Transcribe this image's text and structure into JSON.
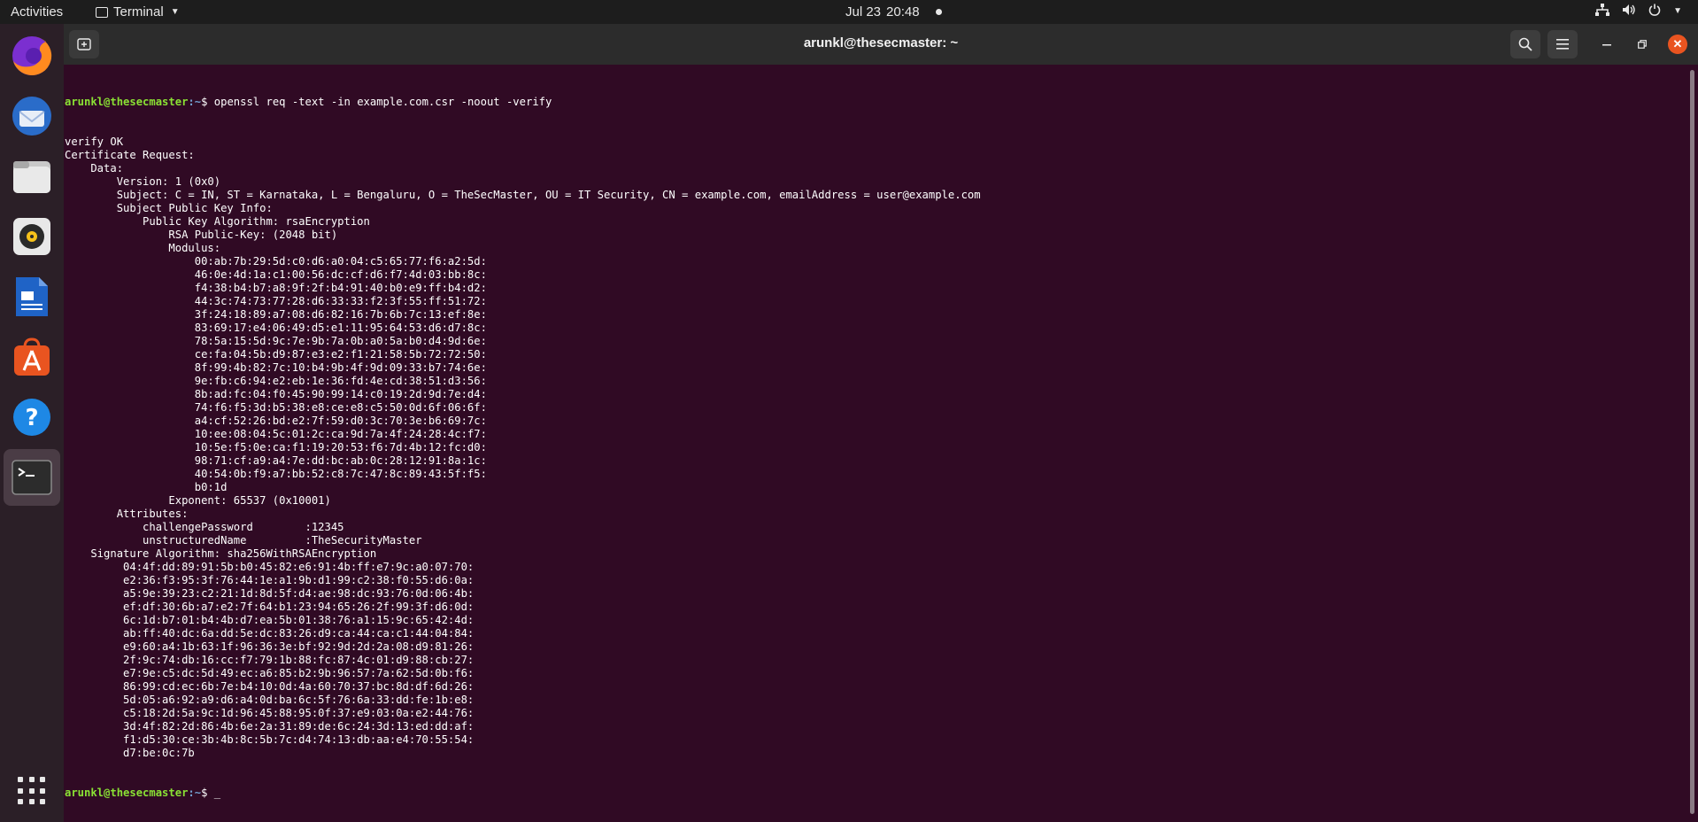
{
  "topbar": {
    "activities": "Activities",
    "app_name": "Terminal",
    "date": "Jul 23",
    "time": "20:48"
  },
  "dock": {
    "items": [
      "firefox-icon",
      "thunderbird-icon",
      "files-icon",
      "rhythmbox-icon",
      "writer-icon",
      "app-center-icon",
      "help-icon",
      "terminal-icon",
      "show-apps-icon"
    ]
  },
  "window": {
    "title": "arunkl@thesecmaster: ~"
  },
  "terminal": {
    "prompt_user": "arunkl@thesecmaster",
    "prompt_path": ":~",
    "command": "$ openssl req -text -in example.com.csr -noout -verify",
    "final_prompt_suffix": "$ _",
    "lines": [
      "verify OK",
      "Certificate Request:",
      "    Data:",
      "        Version: 1 (0x0)",
      "        Subject: C = IN, ST = Karnataka, L = Bengaluru, O = TheSecMaster, OU = IT Security, CN = example.com, emailAddress = user@example.com",
      "        Subject Public Key Info:",
      "            Public Key Algorithm: rsaEncryption",
      "                RSA Public-Key: (2048 bit)",
      "                Modulus:",
      "                    00:ab:7b:29:5d:c0:d6:a0:04:c5:65:77:f6:a2:5d:",
      "                    46:0e:4d:1a:c1:00:56:dc:cf:d6:f7:4d:03:bb:8c:",
      "                    f4:38:b4:b7:a8:9f:2f:b4:91:40:b0:e9:ff:b4:d2:",
      "                    44:3c:74:73:77:28:d6:33:33:f2:3f:55:ff:51:72:",
      "                    3f:24:18:89:a7:08:d6:82:16:7b:6b:7c:13:ef:8e:",
      "                    83:69:17:e4:06:49:d5:e1:11:95:64:53:d6:d7:8c:",
      "                    78:5a:15:5d:9c:7e:9b:7a:0b:a0:5a:b0:d4:9d:6e:",
      "                    ce:fa:04:5b:d9:87:e3:e2:f1:21:58:5b:72:72:50:",
      "                    8f:99:4b:82:7c:10:b4:9b:4f:9d:09:33:b7:74:6e:",
      "                    9e:fb:c6:94:e2:eb:1e:36:fd:4e:cd:38:51:d3:56:",
      "                    8b:ad:fc:04:f0:45:90:99:14:c0:19:2d:9d:7e:d4:",
      "                    74:f6:f5:3d:b5:38:e8:ce:e8:c5:50:0d:6f:06:6f:",
      "                    a4:cf:52:26:bd:e2:7f:59:d0:3c:70:3e:b6:69:7c:",
      "                    10:ee:08:04:5c:01:2c:ca:9d:7a:4f:24:28:4c:f7:",
      "                    10:5e:f5:0e:ca:f1:19:20:53:f6:7d:4b:12:fc:d0:",
      "                    98:71:cf:a9:a4:7e:dd:bc:ab:0c:28:12:91:8a:1c:",
      "                    40:54:0b:f9:a7:bb:52:c8:7c:47:8c:89:43:5f:f5:",
      "                    b0:1d",
      "                Exponent: 65537 (0x10001)",
      "        Attributes:",
      "            challengePassword        :12345",
      "            unstructuredName         :TheSecurityMaster",
      "    Signature Algorithm: sha256WithRSAEncryption",
      "         04:4f:dd:89:91:5b:b0:45:82:e6:91:4b:ff:e7:9c:a0:07:70:",
      "         e2:36:f3:95:3f:76:44:1e:a1:9b:d1:99:c2:38:f0:55:d6:0a:",
      "         a5:9e:39:23:c2:21:1d:8d:5f:d4:ae:98:dc:93:76:0d:06:4b:",
      "         ef:df:30:6b:a7:e2:7f:64:b1:23:94:65:26:2f:99:3f:d6:0d:",
      "         6c:1d:b7:01:b4:4b:d7:ea:5b:01:38:76:a1:15:9c:65:42:4d:",
      "         ab:ff:40:dc:6a:dd:5e:dc:83:26:d9:ca:44:ca:c1:44:04:84:",
      "         e9:60:a4:1b:63:1f:96:36:3e:bf:92:9d:2d:2a:08:d9:81:26:",
      "         2f:9c:74:db:16:cc:f7:79:1b:88:fc:87:4c:01:d9:88:cb:27:",
      "         e7:9e:c5:dc:5d:49:ec:a6:85:b2:9b:96:57:7a:62:5d:0b:f6:",
      "         86:99:cd:ec:6b:7e:b4:10:0d:4a:60:70:37:bc:8d:df:6d:26:",
      "         5d:05:a6:92:a9:d6:a4:0d:ba:6c:5f:76:6a:33:dd:fe:1b:e8:",
      "         c5:18:2d:5a:9c:1d:96:45:88:95:0f:37:e9:03:0a:e2:44:76:",
      "         3d:4f:82:2d:86:4b:6e:2a:31:89:de:6c:24:3d:13:ed:dd:af:",
      "         f1:d5:30:ce:3b:4b:8c:5b:7c:d4:74:13:db:aa:e4:70:55:54:",
      "         d7:be:0c:7b"
    ]
  }
}
